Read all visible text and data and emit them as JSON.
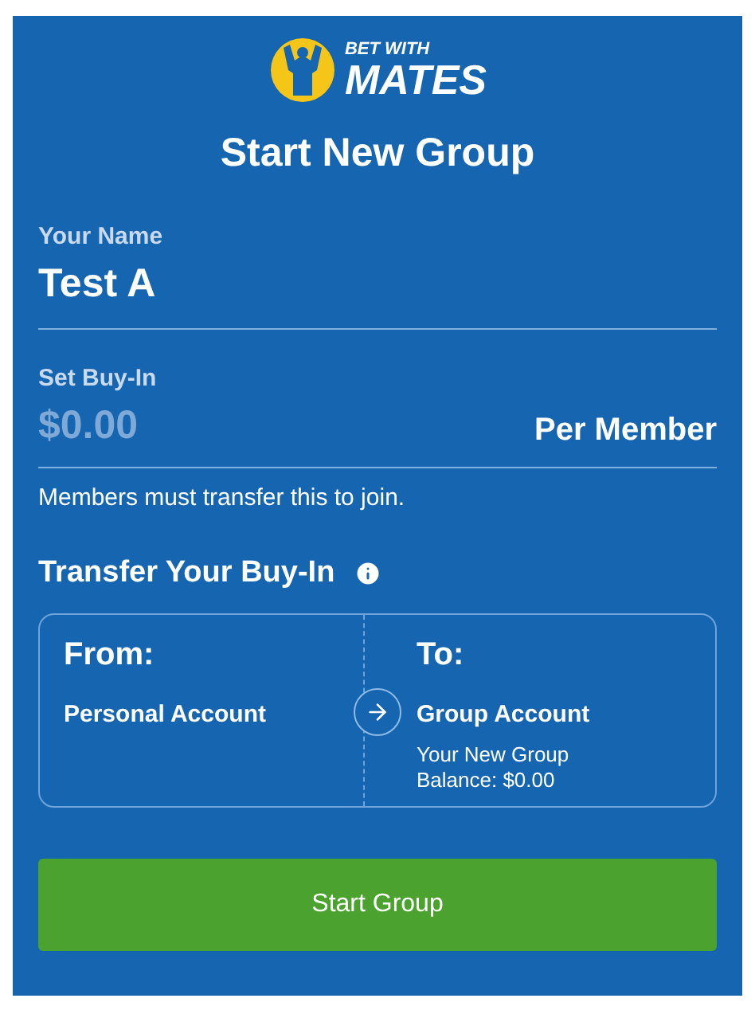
{
  "logo": {
    "line_1": "BET WITH",
    "line_2": "MATES"
  },
  "title": "Start New Group",
  "name_field": {
    "label": "Your Name",
    "value": "Test A"
  },
  "buy_in_field": {
    "label": "Set Buy-In",
    "placeholder": "$0.00",
    "suffix": "Per Member"
  },
  "buy_in_note": "Members must transfer this to join.",
  "transfer": {
    "heading": "Transfer Your Buy-In",
    "from": {
      "label": "From:",
      "account": "Personal Account"
    },
    "to": {
      "label": "To:",
      "account": "Group Account",
      "detail_1": "Your New Group",
      "detail_2": "Balance: $0.00"
    }
  },
  "submit_button": "Start Group"
}
